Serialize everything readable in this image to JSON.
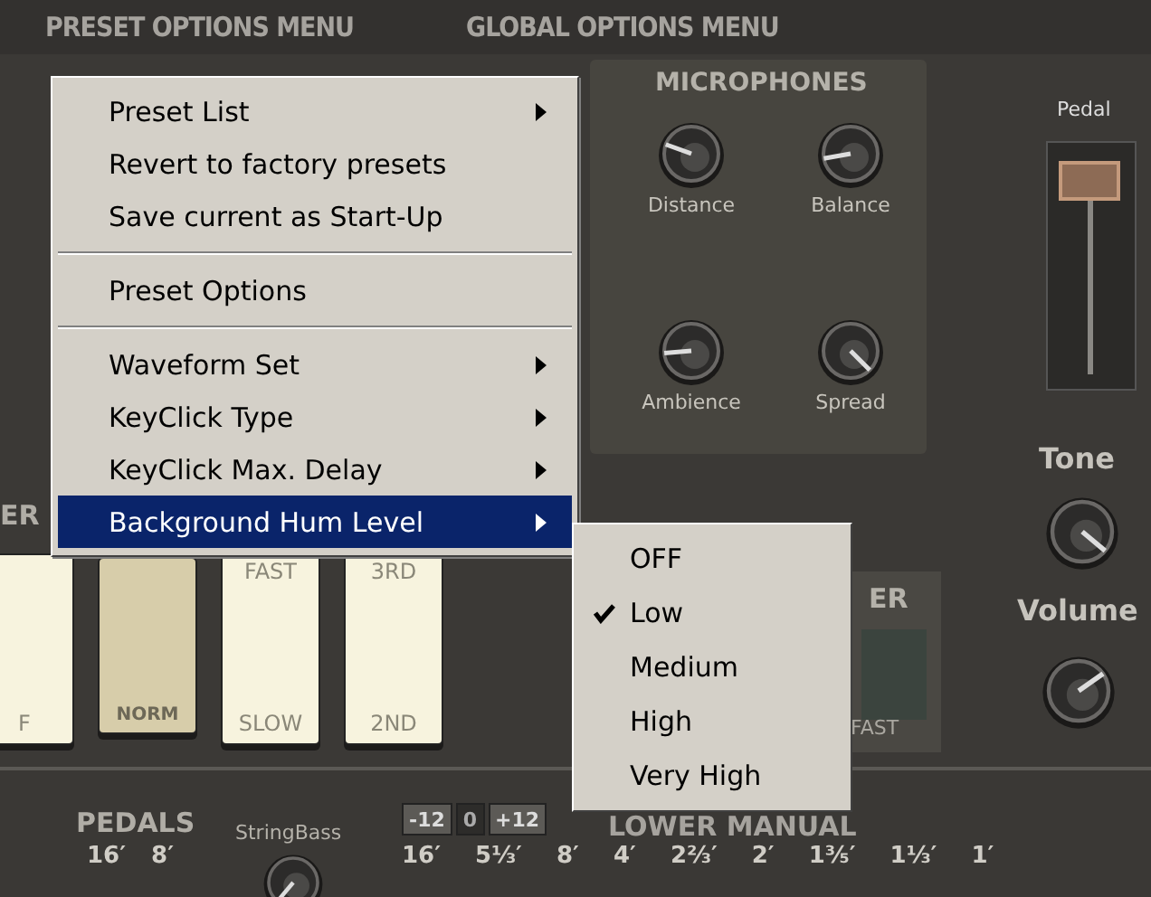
{
  "header": {
    "preset_menu": "PRESET OPTIONS MENU",
    "global_menu": "GLOBAL OPTIONS MENU"
  },
  "microphones": {
    "title": "MICROPHONES",
    "knobs": [
      {
        "label": "Distance"
      },
      {
        "label": "Balance"
      },
      {
        "label": "Ambience"
      },
      {
        "label": "Spread"
      }
    ]
  },
  "pedal_slider": {
    "label": "Pedal",
    "level": 0.95
  },
  "tone": {
    "label": "Tone"
  },
  "volume": {
    "label": "Volume"
  },
  "left_section": {
    "title": "ER",
    "buttons": [
      {
        "bottom": "F",
        "pressed": false
      },
      {
        "bottom": "NORM",
        "pressed": true
      },
      {
        "top": "FAST",
        "bottom": "SLOW",
        "pressed": false
      },
      {
        "top": "3RD",
        "bottom": "2ND",
        "pressed": false
      }
    ]
  },
  "right_section": {
    "title": "ER",
    "bottom": "FAST"
  },
  "pedals": {
    "title": "PEDALS",
    "footages": [
      "16′",
      "8′"
    ],
    "voice": "StringBass"
  },
  "transpose": [
    {
      "label": "-12",
      "selected": false
    },
    {
      "label": "0",
      "selected": true
    },
    {
      "label": "+12",
      "selected": false
    }
  ],
  "lower_manual": {
    "title": "LOWER MANUAL",
    "footages": [
      "16′",
      "5⅓′",
      "8′",
      "4′",
      "2⅔′",
      "2′",
      "1⅗′",
      "1⅓′",
      "1′"
    ]
  },
  "menu": {
    "items": [
      {
        "kind": "item",
        "label": "Preset List",
        "submenu": true,
        "selected": false
      },
      {
        "kind": "item",
        "label": "Revert to factory presets",
        "submenu": false,
        "selected": false
      },
      {
        "kind": "item",
        "label": "Save current as Start-Up",
        "submenu": false,
        "selected": false
      },
      {
        "kind": "separator"
      },
      {
        "kind": "item",
        "label": "Preset Options",
        "submenu": false,
        "selected": false
      },
      {
        "kind": "separator"
      },
      {
        "kind": "item",
        "label": "Waveform Set",
        "submenu": true,
        "selected": false
      },
      {
        "kind": "item",
        "label": "KeyClick Type",
        "submenu": true,
        "selected": false
      },
      {
        "kind": "item",
        "label": "KeyClick Max. Delay",
        "submenu": true,
        "selected": false
      },
      {
        "kind": "item",
        "label": "Background Hum Level",
        "submenu": true,
        "selected": true
      }
    ]
  },
  "submenu": {
    "items": [
      {
        "label": "OFF",
        "checked": false
      },
      {
        "label": "Low",
        "checked": true
      },
      {
        "label": "Medium",
        "checked": false
      },
      {
        "label": "High",
        "checked": false
      },
      {
        "label": "Very High",
        "checked": false
      }
    ]
  }
}
